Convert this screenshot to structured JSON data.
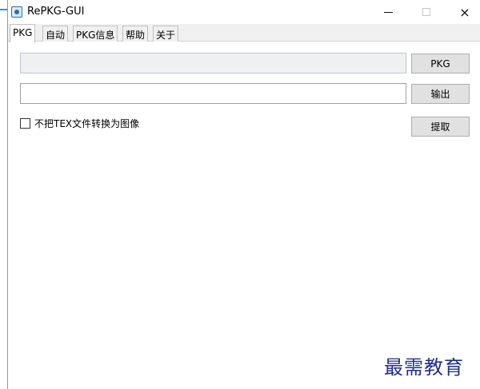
{
  "window": {
    "title": "RePKG-GUI",
    "minimize_symbol": "minimize-icon",
    "maximize_symbol": "maximize-icon",
    "close_symbol": "×"
  },
  "tabs": [
    {
      "label": "PKG"
    },
    {
      "label": "自动"
    },
    {
      "label": "PKG信息"
    },
    {
      "label": "帮助"
    },
    {
      "label": "关于"
    }
  ],
  "pkg_tab": {
    "input_path": {
      "value": "",
      "placeholder": ""
    },
    "output_path": {
      "value": "",
      "placeholder": ""
    },
    "pkg_button": "PKG",
    "output_button": "输出",
    "extract_button": "提取",
    "no_tex_convert_label": "不把TEX文件转换为图像",
    "no_tex_convert_checked": false
  },
  "watermark": "最需教育",
  "colors": {
    "accent": "#3d8fd6",
    "watermark": "#1f2f8a"
  }
}
